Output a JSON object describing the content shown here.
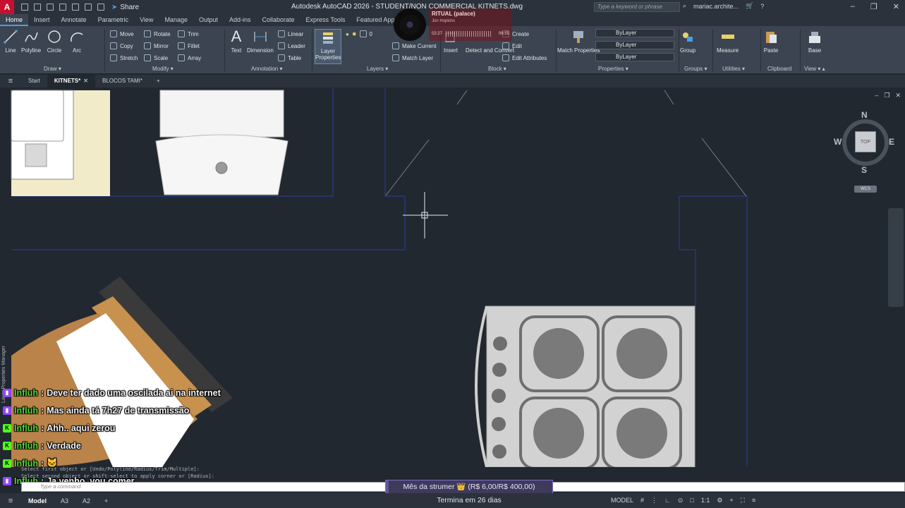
{
  "window": {
    "title": "Autodesk AutoCAD 2026 - STUDENT/NON COMMERCIAL    KITNETS.dwg",
    "app_logo": "A",
    "share_label": "Share",
    "search_placeholder": "Type a keyword or phrase",
    "user": "mariac.archite...",
    "icons": [
      "new-icon",
      "open-icon",
      "save-icon",
      "saveas-icon",
      "print-icon",
      "undo-icon",
      "redo-icon",
      "cart-icon",
      "help-icon"
    ]
  },
  "music": {
    "song": "RITUAL (palace)",
    "artist": "Jon Hopkins",
    "time_now": "02:27",
    "time_end": "06:55"
  },
  "ribbon_tabs": [
    "Home",
    "Insert",
    "Annotate",
    "Parametric",
    "View",
    "Manage",
    "Output",
    "Add-ins",
    "Collaborate",
    "Express Tools",
    "Featured Apps"
  ],
  "ribbon": {
    "draw": {
      "title": "Draw",
      "line": "Line",
      "polyline": "Polyline",
      "circle": "Circle",
      "arc": "Arc"
    },
    "modify": {
      "title": "Modify",
      "move": "Move",
      "rotate": "Rotate",
      "trim": "Trim",
      "copy": "Copy",
      "mirror": "Mirror",
      "fillet": "Fillet",
      "stretch": "Stretch",
      "scale": "Scale",
      "array": "Array"
    },
    "annotation": {
      "title": "Annotation",
      "text": "Text",
      "dimension": "Dimension",
      "linear": "Linear",
      "leader": "Leader",
      "table": "Table"
    },
    "layers": {
      "title": "Layers",
      "layer_properties": "Layer Properties",
      "current_layer": "0",
      "make_current": "Make Current",
      "match_layer": "Match Layer"
    },
    "block": {
      "title": "Block",
      "insert": "Insert",
      "create": "Create",
      "edit": "Edit",
      "detect_convert": "Detect and Convert",
      "edit_attributes": "Edit Attributes"
    },
    "properties": {
      "title": "Properties",
      "match": "Match Properties",
      "color": "ByLayer",
      "linetype": "ByLayer",
      "lineweight": "ByLayer"
    },
    "groups": {
      "title": "Groups",
      "group": "Group"
    },
    "utilities": {
      "title": "Utilities",
      "measure": "Measure"
    },
    "clipboard": {
      "title": "Clipboard",
      "paste": "Paste"
    },
    "view": {
      "title": "View",
      "base": "Base"
    }
  },
  "doc_tabs": {
    "start": "Start",
    "active": "KITNETS*",
    "other": "BLOCOS TAMI*",
    "add": "+"
  },
  "viewcube": {
    "north": "N",
    "south": "S",
    "east": "E",
    "west": "W",
    "face": "TOP",
    "wcs": "WCS"
  },
  "side_panel_label": "Layer Properties Manager",
  "chat": [
    {
      "platform": "twitch",
      "user": "Influh",
      "text": "Deve ter dado uma oscilada ai na internet"
    },
    {
      "platform": "twitch",
      "user": "Influh",
      "text": "Mas ainda tá 7h27 de transmissão"
    },
    {
      "platform": "kick",
      "user": "Influh",
      "text": "Ahh.. aqui zerou"
    },
    {
      "platform": "kick",
      "user": "Influh",
      "text": "Verdade"
    },
    {
      "platform": "kick",
      "user": "Influh",
      "text": "🐱"
    },
    {
      "platform": "twitch",
      "user": "Influh",
      "text": "Ja venho, vou comer"
    }
  ],
  "command": {
    "history_1": "Select first object or [Undo/Polyline/Radius/Trim/Multiple]:",
    "history_2": "Select second object or shift-select to apply corner or [Radius]:",
    "placeholder": "Type a command"
  },
  "goal": {
    "label": "Mês da strumer 👑 (R$ 6,00/R$ 400,00)",
    "progress_fraction": 0.015,
    "subtitle": "Termina em 26 dias"
  },
  "status": {
    "tabs": [
      "Model",
      "A3",
      "A2"
    ],
    "model_label": "MODEL",
    "scale": "1:1"
  }
}
